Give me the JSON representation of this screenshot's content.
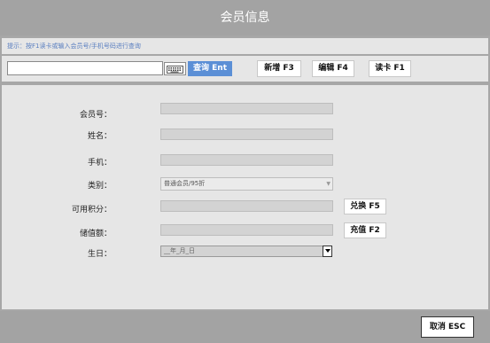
{
  "window": {
    "title": "会员信息"
  },
  "hint": {
    "text": "提示：按F1读卡或输入会员号/手机号码进行查询"
  },
  "toolbar": {
    "search_value": "",
    "search_placeholder": "",
    "query_label": "查询 Ent",
    "add_label": "新增 F3",
    "edit_label": "编辑 F4",
    "read_card_label": "读卡 F1"
  },
  "form": {
    "member_no_label": "会员号：",
    "name_label": "姓名：",
    "phone_label": "手机：",
    "category_label": "类别：",
    "category_value": "普通会员/95折",
    "points_label": "可用积分：",
    "balance_label": "储值额：",
    "birthday_label": "生日：",
    "birthday_value": "__年_月_日",
    "redeem_label": "兑换 F5",
    "recharge_label": "充值 F2"
  },
  "footer": {
    "cancel_label": "取消 ESC"
  },
  "icons": {
    "keyboard": "keyboard-icon",
    "dropdown": "chevron-down-icon",
    "calendar_dropdown": "chevron-down-icon"
  },
  "colors": {
    "accent": "#5b8fd6",
    "hint_text": "#5a7fc0",
    "frame": "#a3a3a3",
    "panel": "#e6e6e6"
  }
}
